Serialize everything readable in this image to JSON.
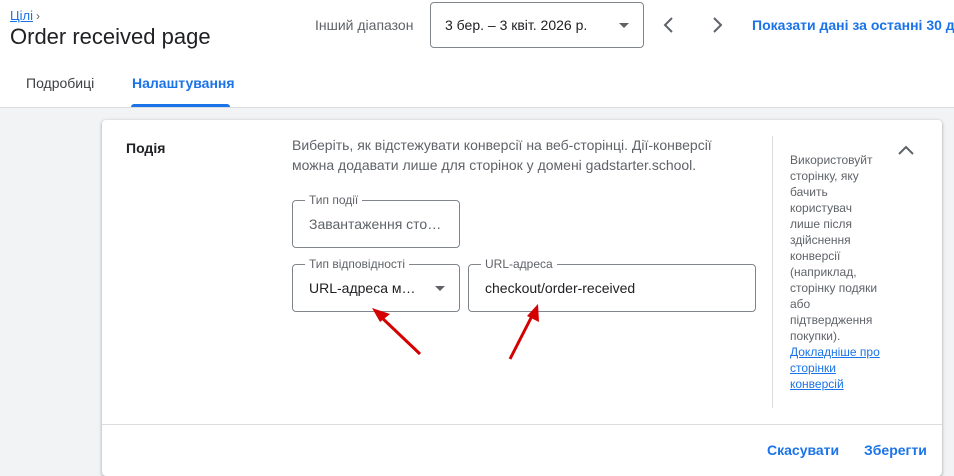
{
  "breadcrumb": {
    "parent": "Цілі"
  },
  "page": {
    "title": "Order received page"
  },
  "date_range": {
    "label": "Інший діапазон",
    "value": "3 бер. – 3 квіт. 2026 р.",
    "show_last_30": "Показати дані за останні 30 д"
  },
  "tabs": [
    {
      "label": "Подробиці",
      "active": false
    },
    {
      "label": "Налаштування",
      "active": true
    }
  ],
  "event_section": {
    "title": "Подія",
    "description": "Виберіть, як відстежувати конверсії на веб-сторінці. Дії-конверсії можна додавати лише для сторінок у домені gadstarter.school.",
    "event_type": {
      "label": "Тип події",
      "value": "Завантаження стор…"
    },
    "match_type": {
      "label": "Тип відповідності",
      "value": "URL-адреса міс…"
    },
    "url": {
      "label": "URL-адреса",
      "value": "checkout/order-received"
    },
    "help_text": "Використовуйт сторінку, яку бачить користувач лише після здійснення конверсії (наприклад, сторінку подяки або підтвердження покупки).",
    "help_link": "Докладніше про сторінки конверсій"
  },
  "actions": {
    "cancel": "Скасувати",
    "save": "Зберегти"
  },
  "colors": {
    "accent": "#1a73e8",
    "annotation_arrow": "#d50000"
  },
  "icons": [
    "chevron-right-icon",
    "dropdown-caret-icon",
    "chevron-left-icon",
    "chevron-up-icon",
    "red-arrow-annotation-icon"
  ]
}
